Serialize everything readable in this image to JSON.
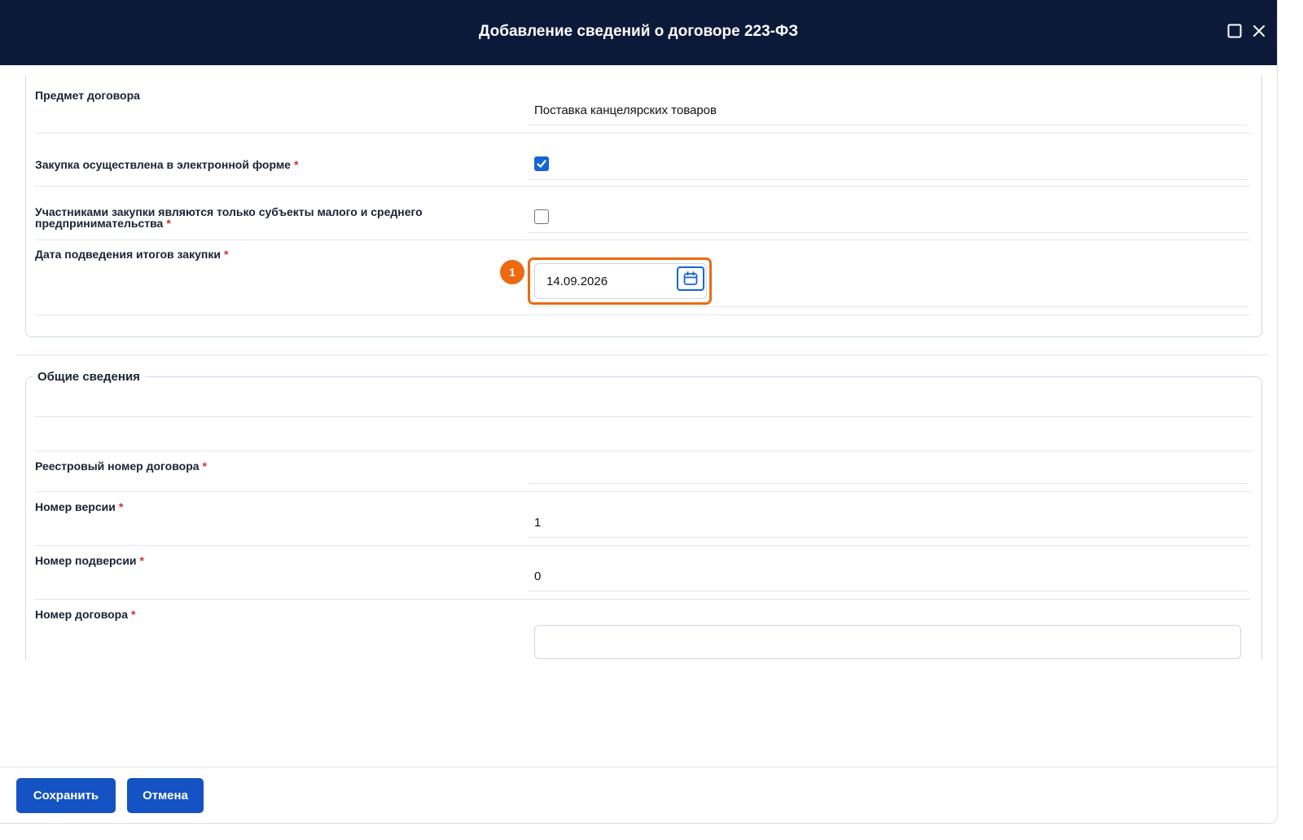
{
  "dialog": {
    "title": "Добавление сведений о договоре 223-ФЗ"
  },
  "section_contract": {
    "subject_label": "Предмет договора",
    "subject_value": "Поставка канцелярских товаров",
    "electronic_label": "Закупка осуществлена в электронной форме",
    "electronic_checked": true,
    "sme_label_line1": "Участниками закупки являются только субъекты малого и среднего",
    "sme_label_line2": "предпринимательства",
    "sme_checked": false,
    "summary_date_label": "Дата подведения итогов закупки",
    "summary_date_value": "14.09.2026",
    "required_mark": "*",
    "step_badge": "1"
  },
  "section_general": {
    "legend": "Общие сведения",
    "registry_number_label": "Реестровый номер договора",
    "registry_number_value": "",
    "version_label": "Номер версии",
    "version_value": "1",
    "subversion_label": "Номер подверсии",
    "subversion_value": "0",
    "contract_number_label": "Номер договора",
    "contract_number_value": ""
  },
  "footer": {
    "save_label": "Сохранить",
    "cancel_label": "Отмена"
  },
  "colors": {
    "header_bg": "#0c1a3a",
    "primary": "#1553c4",
    "highlight": "#ec6a12",
    "required": "#d32f2f"
  },
  "icons": [
    "maximize-icon",
    "close-icon",
    "checkmark-icon",
    "calendar-icon"
  ]
}
